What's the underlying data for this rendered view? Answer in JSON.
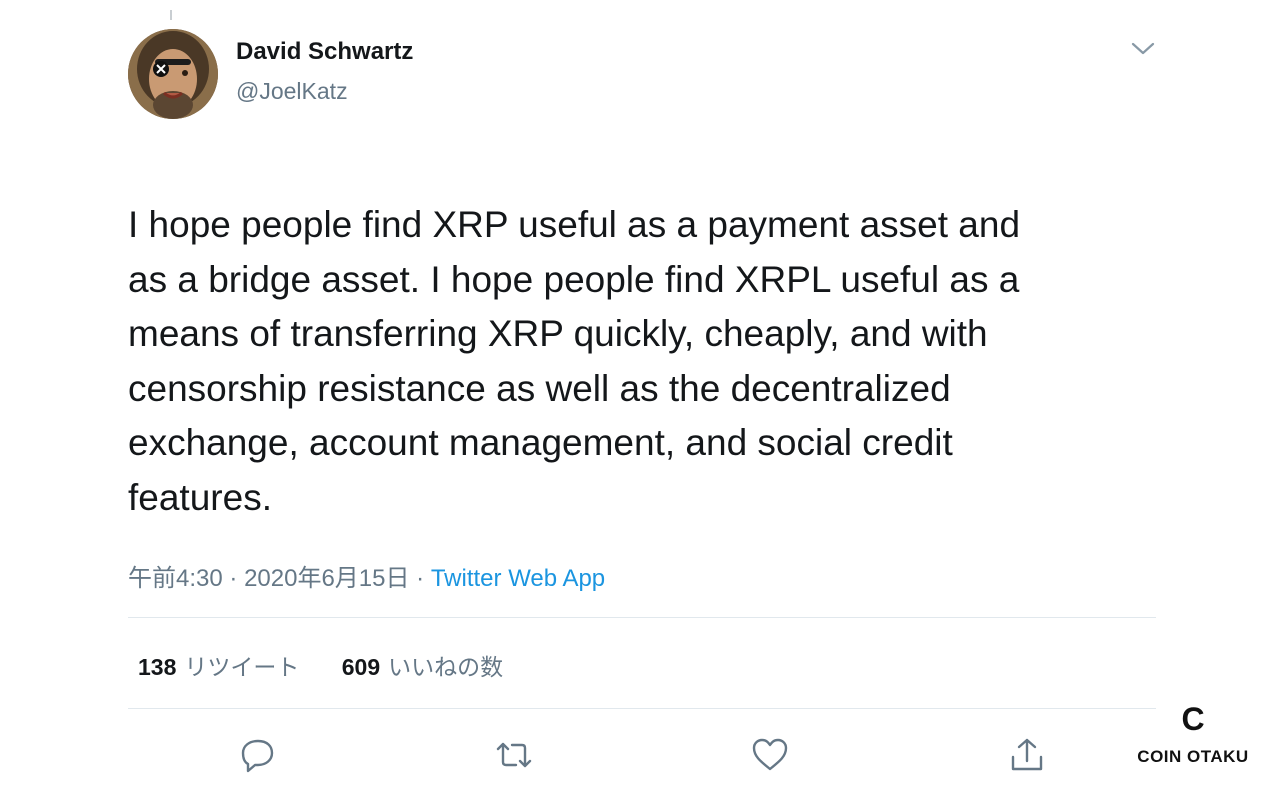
{
  "author": {
    "display_name": "David Schwartz",
    "handle": "@JoelKatz",
    "avatar_icon": "profile-photo"
  },
  "tweet": {
    "text": "I hope people find XRP useful as a payment asset and\nas a bridge asset. I hope people find XRPL useful as a\nmeans of transferring XRP quickly, cheaply, and with\ncensorship resistance as well as the decentralized\nexchange, account management, and social credit\nfeatures.",
    "time": "午前4:30",
    "separator": "·",
    "date": "2020年6月15日",
    "source": "Twitter Web App"
  },
  "stats": {
    "retweets_count": "138",
    "retweets_label": "リツイート",
    "likes_count": "609",
    "likes_label": "いいねの数"
  },
  "actions": {
    "reply_icon": "reply-icon",
    "retweet_icon": "retweet-icon",
    "like_icon": "heart-icon",
    "share_icon": "share-icon",
    "more_icon": "chevron-down-icon"
  },
  "watermark": {
    "brand": "COIN OTAKU",
    "letter": "C"
  },
  "colors": {
    "text": "#14171a",
    "secondary": "#657786",
    "link": "#1b95e0",
    "divider": "#e1e8ed"
  }
}
